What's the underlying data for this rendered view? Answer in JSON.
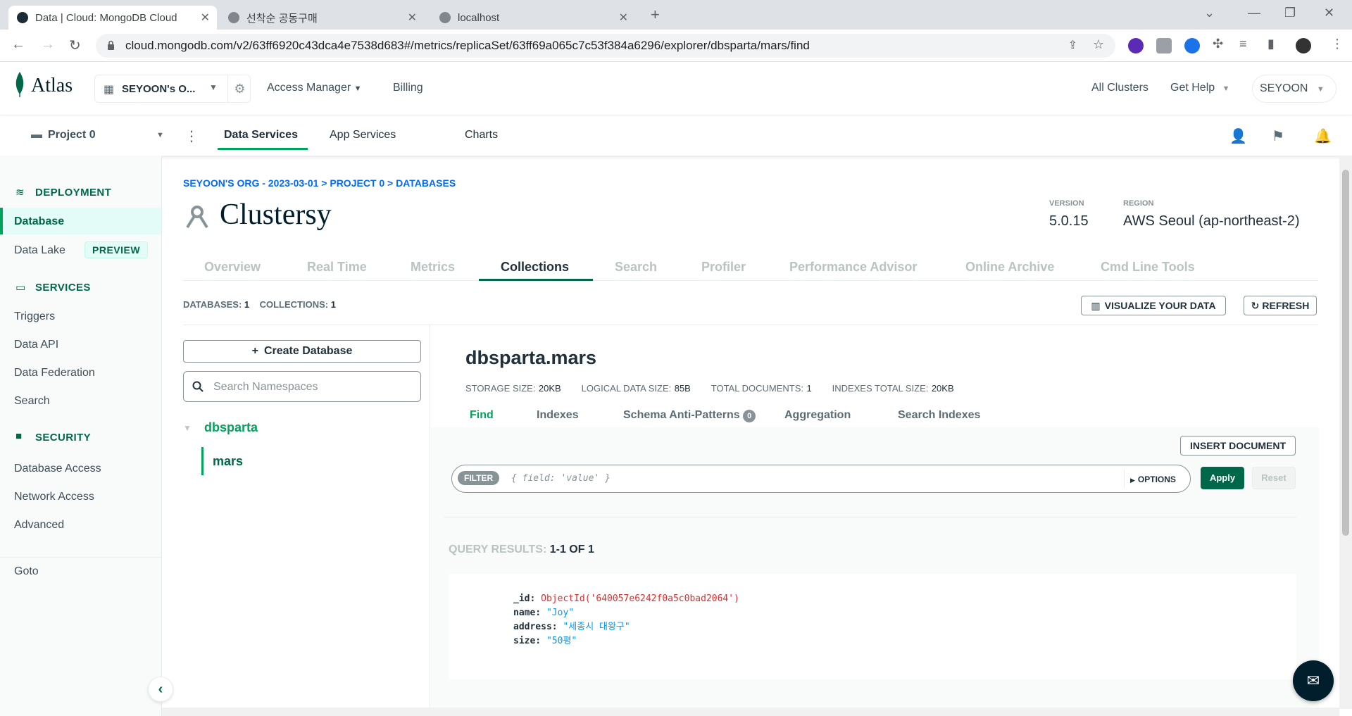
{
  "browser": {
    "tabs": [
      {
        "title": "Data | Cloud: MongoDB Cloud"
      },
      {
        "title": "선착순 공동구매"
      },
      {
        "title": "localhost"
      }
    ],
    "url": "cloud.mongodb.com/v2/63ff6920c43dca4e7538d683#/metrics/replicaSet/63ff69a065c7c53f384a6296/explorer/dbsparta/mars/find"
  },
  "header": {
    "logo": "Atlas",
    "org": "SEYOON's O...",
    "nav": [
      "Access Manager",
      "Billing"
    ],
    "right": {
      "all_clusters": "All Clusters",
      "get_help": "Get Help",
      "user": "SEYOON"
    }
  },
  "project_bar": {
    "project": "Project 0",
    "tabs": [
      "Data Services",
      "App Services",
      "Charts"
    ]
  },
  "sidebar": {
    "deployment": {
      "header": "DEPLOYMENT",
      "items": [
        "Database",
        "Data Lake"
      ],
      "preview_badge": "PREVIEW"
    },
    "services": {
      "header": "SERVICES",
      "items": [
        "Triggers",
        "Data API",
        "Data Federation",
        "Search"
      ]
    },
    "security": {
      "header": "SECURITY",
      "items": [
        "Database Access",
        "Network Access",
        "Advanced"
      ]
    },
    "goto": "Goto"
  },
  "main": {
    "breadcrumb": "SEYOON'S ORG - 2023-03-01 > PROJECT 0 > DATABASES",
    "cluster_name": "Clustersy",
    "version_label": "VERSION",
    "version": "5.0.15",
    "region_label": "REGION",
    "region": "AWS Seoul (ap-northeast-2)",
    "tabs": [
      "Overview",
      "Real Time",
      "Metrics",
      "Collections",
      "Search",
      "Profiler",
      "Performance Advisor",
      "Online Archive",
      "Cmd Line Tools"
    ],
    "counts": {
      "databases_label": "DATABASES:",
      "databases": "1",
      "collections_label": "COLLECTIONS:",
      "collections": "1"
    },
    "visualize_button": "VISUALIZE YOUR DATA",
    "refresh_button": "REFRESH",
    "create_db_button": "Create Database",
    "search_placeholder": "Search Namespaces",
    "tree": {
      "database": "dbsparta",
      "collection": "mars"
    },
    "collection": {
      "title": "dbsparta.mars",
      "storage_label": "STORAGE SIZE:",
      "storage": "20KB",
      "logical_label": "LOGICAL DATA SIZE:",
      "logical": "85B",
      "docs_label": "TOTAL DOCUMENTS:",
      "docs": "1",
      "indexes_label": "INDEXES TOTAL SIZE:",
      "indexes": "20KB",
      "subtabs": [
        "Find",
        "Indexes",
        "Schema Anti-Patterns",
        "Aggregation",
        "Search Indexes"
      ],
      "anti_patterns_count": "0",
      "insert_button": "INSERT DOCUMENT",
      "filter_label": "FILTER",
      "filter_placeholder": "{ field: 'value' }",
      "options_button": "OPTIONS",
      "apply_button": "Apply",
      "reset_button": "Reset",
      "results_label": "QUERY RESULTS:",
      "results_range": "1-1 OF 1",
      "document": {
        "id_key": "_id:",
        "id_value": "ObjectId('640057e6242f0a5c0bad2064')",
        "name_key": "name:",
        "name_value": "\"Joy\"",
        "address_key": "address:",
        "address_value": "\"세종시 대왕구\"",
        "size_key": "size:",
        "size_value": "\"50평\""
      }
    }
  },
  "colors": {
    "brand_green": "#00684a",
    "accent_green": "#00a35c",
    "apply_bg": "#00684a"
  }
}
